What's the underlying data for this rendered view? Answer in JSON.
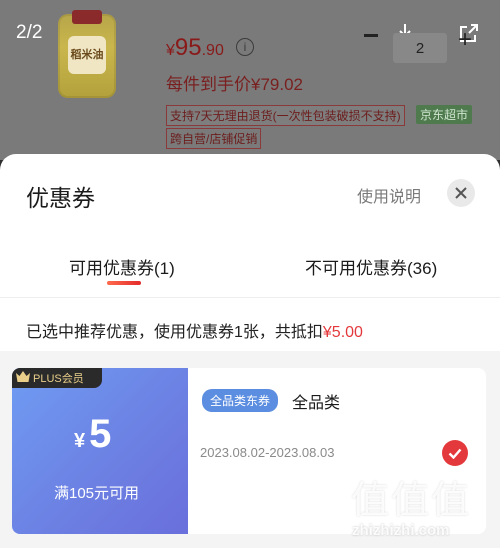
{
  "gallery": {
    "counter": "2/2"
  },
  "product": {
    "thumb_label": "稻米油",
    "price_yen": "¥",
    "price_int": "95",
    "price_dec": ".90",
    "final_price": "每件到手价¥79.02",
    "quantity": "2",
    "tag_return": "支持7天无理由退货(一次性包装破损不支持)",
    "tag_market": "京东超市",
    "tag_self": "跨自营/店铺促销",
    "info_icon": "i"
  },
  "icons": {
    "download": "download-icon",
    "share": "share-icon",
    "close": "close-icon",
    "check": "check-icon",
    "crown": "crown-icon"
  },
  "sheet": {
    "title": "优惠券",
    "usage_link": "使用说明",
    "tabs": [
      {
        "label": "可用优惠券(1)"
      },
      {
        "label": "不可用优惠券(36)"
      }
    ],
    "summary_prefix": "已选中推荐优惠，使用优惠券1张，共抵扣",
    "summary_amount": "¥5.00"
  },
  "coupon": {
    "badge": "PLUS会员",
    "yen": "¥",
    "amount": "5",
    "condition": "满105元可用",
    "scope_badge": "全品类东券",
    "scope": "全品类",
    "date_range": "2023.08.02-2023.08.03"
  },
  "watermark": {
    "glyphs": "值值值",
    "domain": "zhizhizhi.com"
  },
  "colors": {
    "accent_red": "#e4393c",
    "coupon_blue": "#6c7fe2",
    "scope_badge_blue": "#5b8de0"
  }
}
